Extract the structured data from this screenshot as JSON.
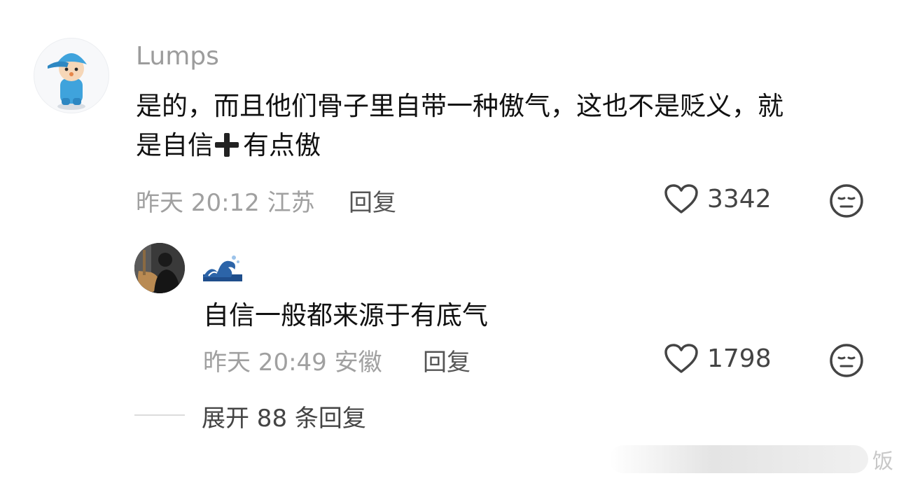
{
  "comment": {
    "username": "Lumps",
    "text_line1": "是的，而且他们骨子里自带一种傲气，这也不是贬义，就",
    "text_line2_before": "是自信",
    "text_line2_after": "有点傲",
    "time": "昨天 20:12",
    "location": "江苏",
    "reply_label": "回复",
    "likes": "3342"
  },
  "reply": {
    "username_icon": "wave-icon",
    "text": "自信一般都来源于有底气",
    "time": "昨天 20:49",
    "location": "安徽",
    "reply_label": "回复",
    "likes": "1798"
  },
  "expand_label": "展开 88 条回复",
  "watermark": "饭"
}
